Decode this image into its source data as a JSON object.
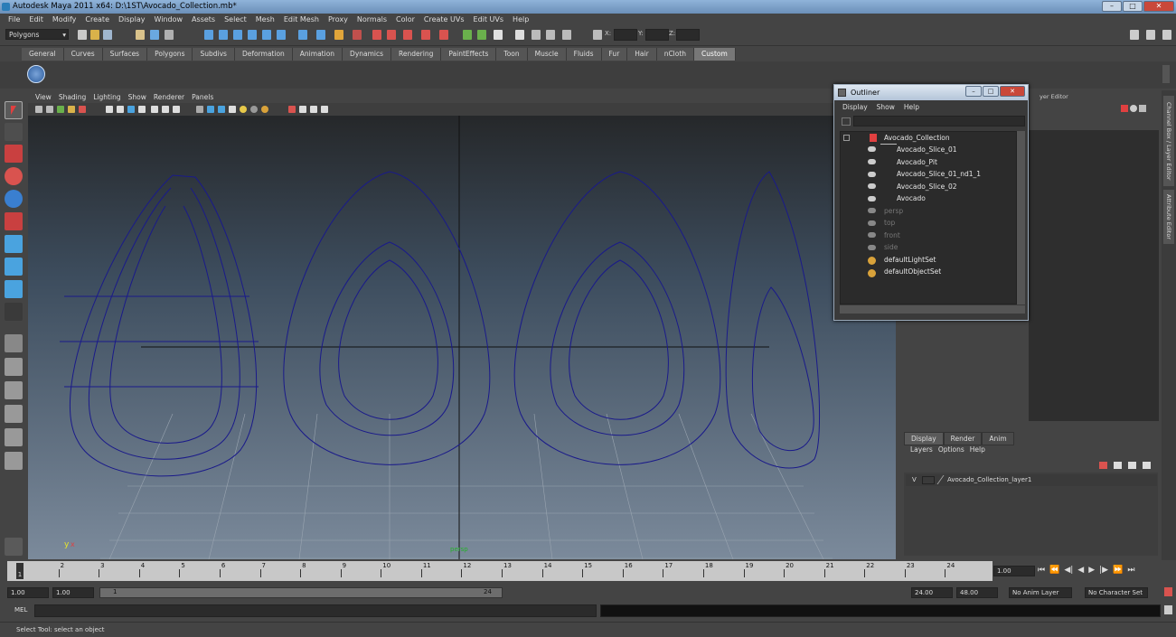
{
  "window": {
    "title": "Autodesk Maya 2011 x64: D:\\1ST\\Avocado_Collection.mb*",
    "min": "–",
    "max": "□",
    "close": "✕"
  },
  "menubar": [
    "File",
    "Edit",
    "Modify",
    "Create",
    "Display",
    "Window",
    "Assets",
    "Select",
    "Mesh",
    "Edit Mesh",
    "Proxy",
    "Normals",
    "Color",
    "Create UVs",
    "Edit UVs",
    "Help"
  ],
  "toolbar": {
    "mode": "Polygons",
    "x_label": "X:",
    "y_label": "Y:",
    "z_label": "Z:"
  },
  "shelf_tabs": [
    "General",
    "Curves",
    "Surfaces",
    "Polygons",
    "Subdivs",
    "Deformation",
    "Animation",
    "Dynamics",
    "Rendering",
    "PaintEffects",
    "Toon",
    "Muscle",
    "Fluids",
    "Fur",
    "Hair",
    "nCloth",
    "Custom"
  ],
  "shelf_active": "Custom",
  "viewport": {
    "menu": [
      "View",
      "Shading",
      "Lighting",
      "Show",
      "Renderer",
      "Panels"
    ],
    "camera_label": "persp",
    "axis_y": "y",
    "axis_x": "x"
  },
  "outliner": {
    "title": "Outliner",
    "menu": [
      "Display",
      "Show",
      "Help"
    ],
    "items": [
      {
        "label": "Avocado_Collection",
        "dim": false
      },
      {
        "label": "Avocado_Slice_01",
        "dim": false
      },
      {
        "label": "Avocado_Pit",
        "dim": false
      },
      {
        "label": "Avocado_Slice_01_nd1_1",
        "dim": false
      },
      {
        "label": "Avocado_Slice_02",
        "dim": false
      },
      {
        "label": "Avocado",
        "dim": false
      },
      {
        "label": "persp",
        "dim": true
      },
      {
        "label": "top",
        "dim": true
      },
      {
        "label": "front",
        "dim": true
      },
      {
        "label": "side",
        "dim": true
      },
      {
        "label": "defaultLightSet",
        "dim": false
      },
      {
        "label": "defaultObjectSet",
        "dim": false
      }
    ]
  },
  "right_panel": {
    "header": "yer Editor",
    "side_tabs": [
      "Channel Box / Layer Editor",
      "Attribute Editor"
    ]
  },
  "layers": {
    "tabs": [
      "Display",
      "Render",
      "Anim"
    ],
    "active_tab": "Display",
    "menu": [
      "Layers",
      "Options",
      "Help"
    ],
    "layer_visible": "V",
    "layer_name": "Avocado_Collection_layer1"
  },
  "timeline": {
    "frames": [
      "1",
      "2",
      "3",
      "4",
      "5",
      "6",
      "7",
      "8",
      "9",
      "10",
      "11",
      "12",
      "13",
      "14",
      "15",
      "16",
      "17",
      "18",
      "19",
      "20",
      "21",
      "22",
      "23",
      "24"
    ],
    "current_frame": "1.00",
    "current_marker": "1"
  },
  "range": {
    "start": "1.00",
    "start2": "1.00",
    "range_start": "1",
    "range_end": "24",
    "end": "24.00",
    "end2": "48.00",
    "anim_layer": "No Anim Layer",
    "char_set": "No Character Set"
  },
  "mel": {
    "label": "MEL"
  },
  "status": {
    "text": "Select Tool: select an object"
  }
}
